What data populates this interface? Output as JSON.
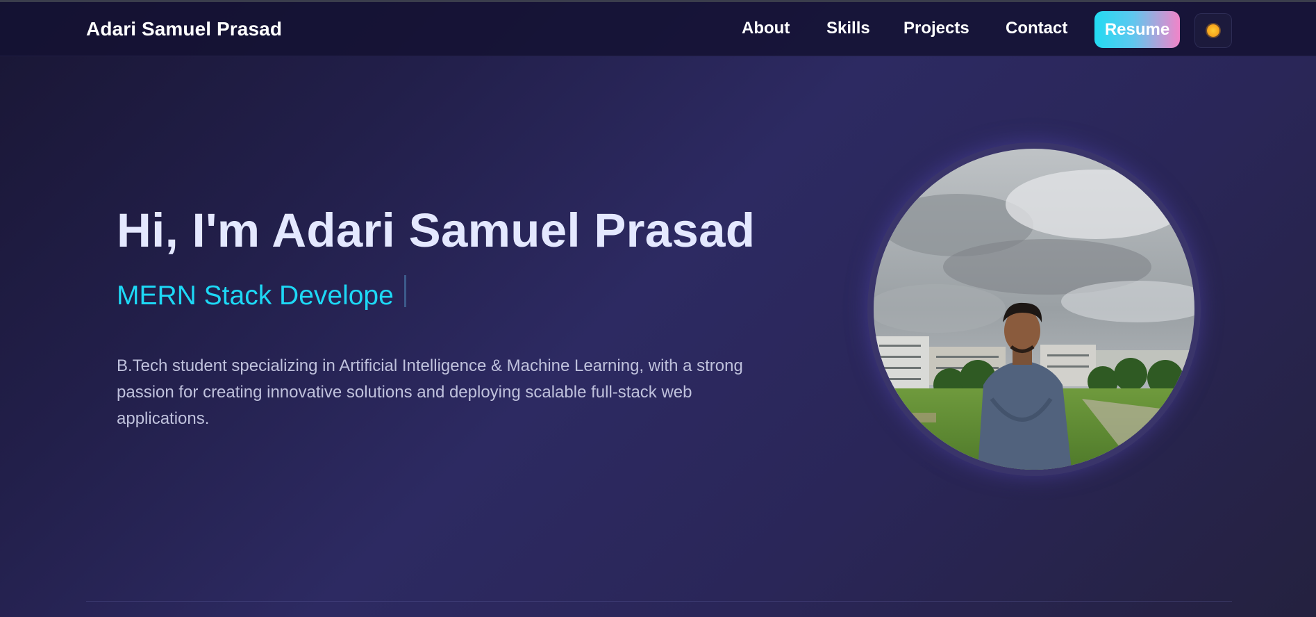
{
  "header": {
    "brand": "Adari Samuel Prasad",
    "nav": [
      {
        "label": "About"
      },
      {
        "label": "Skills"
      },
      {
        "label": "Projects"
      },
      {
        "label": "Contact"
      }
    ],
    "resume_label": "Resume",
    "theme_icon": "sun-icon"
  },
  "hero": {
    "title": "Hi, I'm Adari Samuel Prasad",
    "role": "MERN Stack Develope",
    "description": "B.Tech student specializing in Artificial Intelligence & Machine Learning, with a strong passion for creating innovative solutions and deploying scalable full-stack web applications."
  },
  "colors": {
    "accent_cyan": "#1dd8f5",
    "resume_gradient_start": "#22dbf2",
    "resume_gradient_end": "#f184c8",
    "background": "#2d2a62"
  }
}
